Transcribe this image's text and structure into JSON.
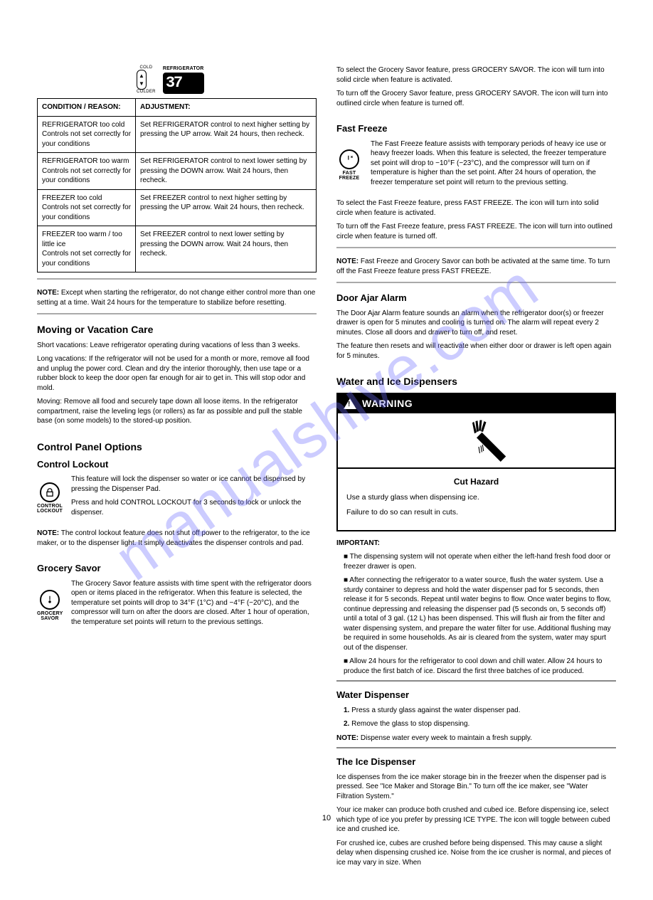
{
  "watermark": "manualshive.com",
  "left": {
    "panel": {
      "cold": "COLD",
      "colder": "COLDER",
      "refrigerator": "REFRIGERATOR",
      "value": "37"
    },
    "table": {
      "h1": "CONDITION / REASON:",
      "h2": "ADJUSTMENT:",
      "rows": [
        [
          "REFRIGERATOR too cold\nControls not set correctly for your conditions",
          "Set REFRIGERATOR control to next higher setting by pressing the UP arrow. Wait 24 hours, then recheck."
        ],
        [
          "REFRIGERATOR too warm\nControls not set correctly for your conditions",
          "Set REFRIGERATOR control to next lower setting by pressing the DOWN arrow. Wait 24 hours, then recheck."
        ],
        [
          "FREEZER too cold\nControls not set correctly for your conditions",
          "Set FREEZER control to next higher setting by pressing the UP arrow. Wait 24 hours, then recheck."
        ],
        [
          "FREEZER too warm / too little ice\nControls not set correctly for your conditions",
          "Set FREEZER control to next lower setting by pressing the DOWN arrow. Wait 24 hours, then recheck."
        ]
      ]
    },
    "note1_label": "NOTE:",
    "note1": " Except when starting the refrigerator, do not change either control more than one setting at a time. Wait 24 hours for the temperature to stabilize before resetting.",
    "vac_title": "Moving or Vacation Care",
    "vac_p1": "Short vacations: Leave refrigerator operating during vacations of less than 3 weeks.",
    "vac_p2": "Long vacations: If the refrigerator will not be used for a month or more, remove all food and unplug the power cord. Clean and dry the interior thoroughly, then use tape or a rubber block to keep the door open far enough for air to get in. This will stop odor and mold.",
    "vac_p3": "Moving: Remove all food and securely tape down all loose items. In the refrigerator compartment, raise the leveling legs (or rollers) as far as possible and pull the stable base (on some models) to the stored-up position.",
    "cpo_title": "Control Panel Options",
    "cpo_lockout": "Control Lockout",
    "cpo_ico_lockout": "CONTROL\nLOCKOUT",
    "cpo_lockout_p1": "This feature will lock the dispenser so water or ice cannot be dispensed by pressing the Dispenser Pad.",
    "cpo_lockout_p2": "Press and hold CONTROL LOCKOUT for 3 seconds to lock or unlock the dispenser.",
    "cpo_note_label": "NOTE:",
    "cpo_note": " The control lockout feature does not shut off power to the refrigerator, to the ice maker, or to the dispenser light. It simply deactivates the dispenser controls and pad.",
    "cpo_savor": "Grocery Savor",
    "cpo_ico_savor": "GROCERY\nSAVOR",
    "cpo_savor_p": "The Grocery Savor feature assists with time spent with the refrigerator doors open or items placed in the refrigerator. When this feature is selected, the temperature set points will drop to 34°F (1°C) and −4°F (−20°C), and the compressor will turn on after the doors are closed. After 1 hour of operation, the temperature set points will return to the previous settings."
  },
  "right": {
    "gs_p1": "To select the Grocery Savor feature, press GROCERY SAVOR. The icon will turn into solid circle when feature is activated.",
    "gs_p2": "To turn off the Grocery Savor feature, press GROCERY SAVOR. The icon will turn into outlined circle when feature is turned off.",
    "ff_title": "Fast Freeze",
    "ff_ico": "FAST\nFREEZE",
    "ff_p": "The Fast Freeze feature assists with temporary periods of heavy ice use or heavy freezer loads. When this feature is selected, the freezer temperature set point will drop to −10°F (−23°C), and the compressor will turn on if temperature is higher than the set point. After 24 hours of operation, the freezer temperature set point will return to the previous setting.",
    "ff_on": "To select the Fast Freeze feature, press FAST FREEZE. The icon will turn into solid circle when feature is activated.",
    "ff_off": "To turn off the Fast Freeze feature, press FAST FREEZE. The icon will turn into outlined circle when feature is turned off.",
    "ff_note_label": "NOTE:",
    "ff_note": " Fast Freeze and Grocery Savor can both be activated at the same time. To turn off the Fast Freeze feature press FAST FREEZE.",
    "alarm_title": "Door Ajar Alarm",
    "alarm_p": "The Door Ajar Alarm feature sounds an alarm when the refrigerator door(s) or freezer drawer is open for 5 minutes and cooling is turned on. The alarm will repeat every 2 minutes. Close all doors and drawer to turn off, and reset.",
    "alarm_p2": "The feature then resets and will reactivate when either door or drawer is left open again for 5 minutes.",
    "disp_title": "Water and Ice Dispensers",
    "warn_label": "WARNING",
    "warn_head": "Cut Hazard",
    "warn_l1": "Use a sturdy glass when dispensing ice.",
    "warn_l2": "Failure to do so can result in cuts.",
    "imp_label": "IMPORTANT:",
    "imp_p1": "The dispensing system will not operate when either the left-hand fresh food door or freezer drawer is open.",
    "imp_p2": "After connecting the refrigerator to a water source, flush the water system. Use a sturdy container to depress and hold the water dispenser pad for 5 seconds, then release it for 5 seconds. Repeat until water begins to flow. Once water begins to flow, continue depressing and releasing the dispenser pad (5 seconds on, 5 seconds off) until a total of 3 gal. (12 L) has been dispensed. This will flush air from the filter and water dispensing system, and prepare the water filter for use. Additional flushing may be required in some households. As air is cleared from the system, water may spurt out of the dispenser.",
    "imp_p3": "Allow 24 hours for the refrigerator to cool down and chill water. Allow 24 hours to produce the first batch of ice. Discard the first three batches of ice produced.",
    "wd_title": "Water Dispenser",
    "wd_steps": [
      "Press a sturdy glass against the water dispenser pad.",
      "Remove the glass to stop dispensing."
    ],
    "wd_note_label": "NOTE:",
    "wd_note": " Dispense water every week to maintain a fresh supply.",
    "id_title": "The Ice Dispenser",
    "id_p1": "Ice dispenses from the ice maker storage bin in the freezer when the dispenser pad is pressed. See \"Ice Maker and Storage Bin.\" To turn off the ice maker, see \"Water Filtration System.\"",
    "id_p2": "Your ice maker can produce both crushed and cubed ice. Before dispensing ice, select which type of ice you prefer by pressing ICE TYPE. The icon will toggle between cubed ice and crushed ice.",
    "id_p3": "For crushed ice, cubes are crushed before being dispensed. This may cause a slight delay when dispensing crushed ice. Noise from the ice crusher is normal, and pieces of ice may vary in size. When"
  },
  "page_number": "10"
}
